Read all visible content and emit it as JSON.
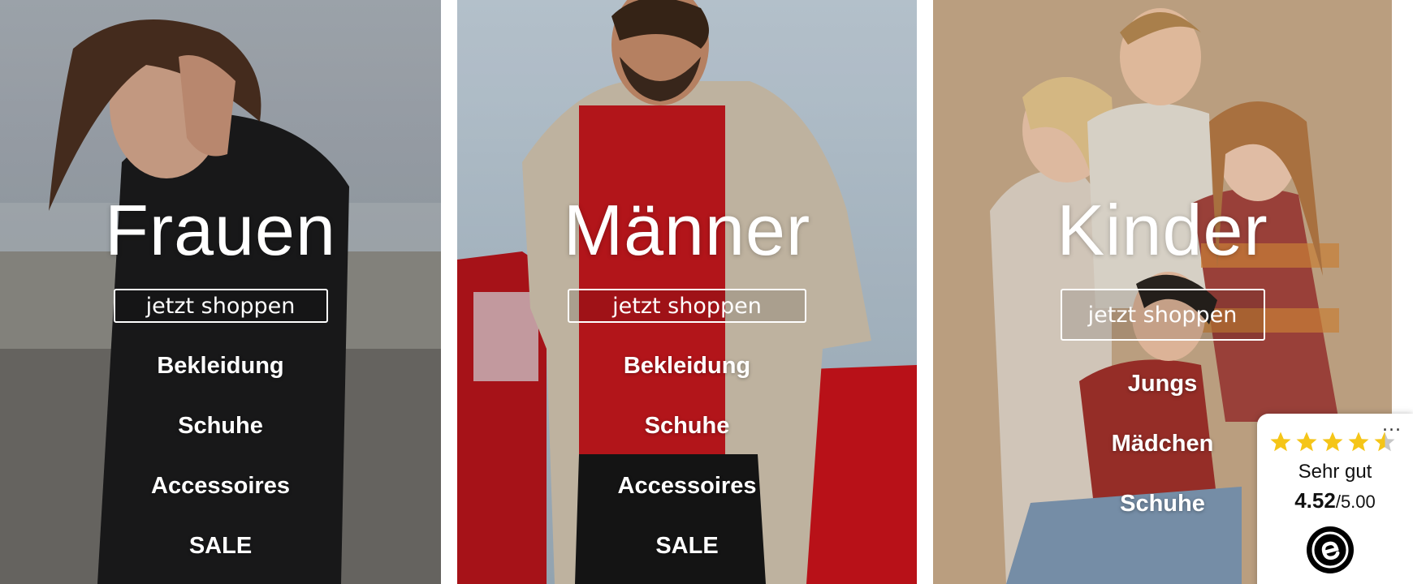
{
  "panels": [
    {
      "title": "Frauen",
      "button_label": "jetzt shoppen",
      "categories": [
        "Bekleidung",
        "Schuhe",
        "Accessoires",
        "SALE"
      ]
    },
    {
      "title": "Männer",
      "button_label": "jetzt shoppen",
      "categories": [
        "Bekleidung",
        "Schuhe",
        "Accessoires",
        "SALE"
      ]
    },
    {
      "title": "Kinder",
      "button_label": "jetzt shoppen",
      "categories": [
        "Jungs",
        "Mädchen",
        "Schuhe"
      ]
    }
  ],
  "rating_badge": {
    "more_label": "...",
    "stars_icon": "star-icon",
    "stars_value": 4.52,
    "label": "Sehr gut",
    "score": "4.52",
    "max": "/5.00",
    "logo_icon": "trusted-shops-e-icon",
    "star_color": "#f5c518"
  },
  "colors": {
    "text_on_photo": "#ffffff",
    "frauen_bg": "#8d9299",
    "maenner_bg": "#a8b8c4",
    "kinder_bg": "#c9ad8b",
    "car_red": "#c8131b"
  }
}
